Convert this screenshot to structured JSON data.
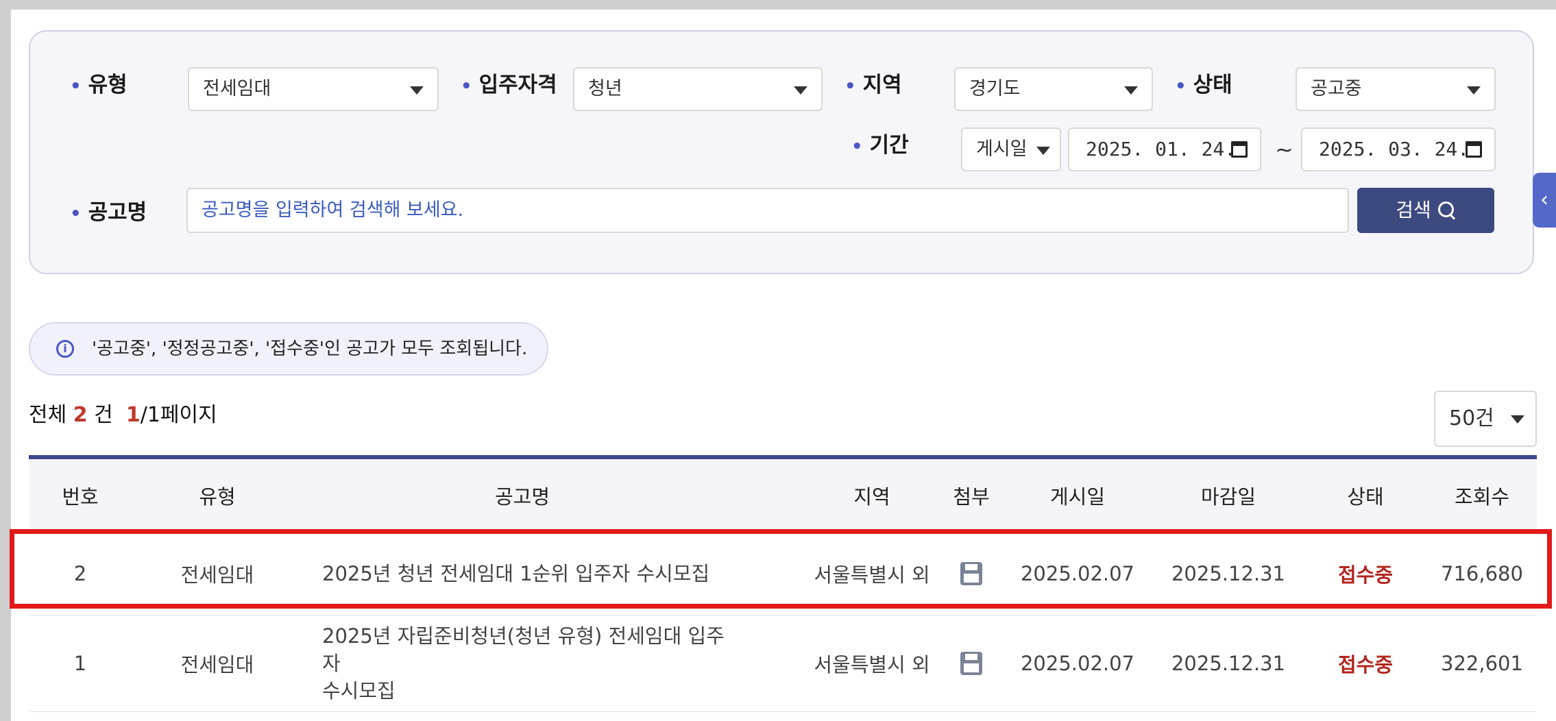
{
  "filters": {
    "type": {
      "label": "유형",
      "value": "전세임대"
    },
    "eligibility": {
      "label": "입주자격",
      "value": "청년"
    },
    "region": {
      "label": "지역",
      "value": "경기도"
    },
    "status": {
      "label": "상태",
      "value": "공고중"
    },
    "period": {
      "label": "기간",
      "basis": "게시일",
      "start": "2025. 01. 24.",
      "tilde": "~",
      "end": "2025. 03. 24."
    },
    "notice_name": {
      "label": "공고명",
      "placeholder": "공고명을 입력하여 검색해 보세요."
    },
    "search_button": "검색"
  },
  "side_tab": {
    "glyph": "‹"
  },
  "info_notice": {
    "icon": "i",
    "text": "'공고중', '정정공고중', '접수중'인 공고가 모두 조회됩니다."
  },
  "summary": {
    "total_prefix": "전체",
    "total": "2",
    "total_suffix": "건",
    "current_page": "1",
    "page_suffix": "/1페이지"
  },
  "page_size": "50건",
  "table": {
    "headers": {
      "no": "번호",
      "type": "유형",
      "title": "공고명",
      "region": "지역",
      "attach": "첨부",
      "posted": "게시일",
      "deadline": "마감일",
      "status": "상태",
      "views": "조회수"
    },
    "rows": [
      {
        "no": "2",
        "type": "전세임대",
        "title": "2025년 청년 전세임대 1순위 입주자 수시모집",
        "region": "서울특별시 외",
        "attach_icon": "floppy-disk-icon",
        "posted": "2025.02.07",
        "deadline": "2025.12.31",
        "status": "접수중",
        "views": "716,680",
        "highlighted": true
      },
      {
        "no": "1",
        "type": "전세임대",
        "title_line1": "2025년 자립준비청년(청년 유형) 전세임대 입주자",
        "title_line2": "수시모집",
        "region": "서울특별시 외",
        "attach_icon": "floppy-disk-icon",
        "posted": "2025.02.07",
        "deadline": "2025.12.31",
        "status": "접수중",
        "views": "322,601",
        "highlighted": false
      }
    ]
  },
  "colors": {
    "accent": "#4a56c4",
    "button": "#3d4a80",
    "status": "#b3261e",
    "highlight": "#e01a1a"
  }
}
